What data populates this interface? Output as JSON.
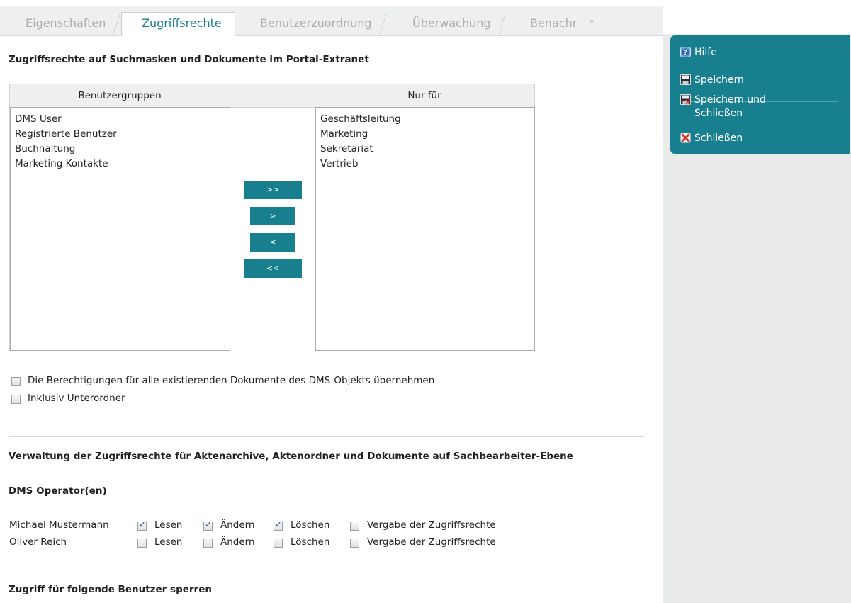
{
  "tabs": [
    "Eigenschaften",
    "Zugriffsrechte",
    "Benutzerzuordnung",
    "Überwachung",
    "Benachr"
  ],
  "tab_more": "»",
  "section_title": "Zugriffsrechte auf Suchmasken und Dokumente im Portal-Extranet",
  "transfer": {
    "left_header": "Benutzergruppen",
    "right_header": "Nur für",
    "left_items": [
      "DMS User",
      "Registrierte Benutzer",
      "Buchhaltung",
      "Marketing Kontakte"
    ],
    "right_items": [
      "Geschäftsleitung",
      "Marketing",
      "Sekretariat",
      "Vertrieb"
    ],
    "buttons": [
      ">>",
      ">",
      "<",
      "<<"
    ]
  },
  "options": {
    "apply_existing": "Die Berechtigungen für alle existierenden Dokumente des DMS-Objekts übernehmen",
    "include_subfolders": "Inklusiv Unterordner"
  },
  "management_title": "Verwaltung der Zugriffsrechte für Aktenarchive, Aktenordner und Dokumente auf Sachbearbeiter-Ebene",
  "operators_title": "DMS Operator(en)",
  "perm_labels": {
    "read": "Lesen",
    "change": "Ändern",
    "delete": "Löschen",
    "grant": "Vergabe der Zugriffsrechte"
  },
  "operators": [
    {
      "name": "Michael Mustermann",
      "read": true,
      "change": true,
      "delete": true,
      "grant": false
    },
    {
      "name": "Oliver Reich",
      "read": false,
      "change": false,
      "delete": false,
      "grant": false
    }
  ],
  "block_title": "Zugriff für folgende Benutzer sperren",
  "actions": {
    "help": "Hilfe",
    "save": "Speichern",
    "save_close": "Speichern und Schließen",
    "save_close_line1": "Speichern und",
    "save_close_line2": "Schließen",
    "close": "Schließen"
  },
  "colors": {
    "accent": "#177f8e",
    "active_tab_text": "#1a7f92",
    "close_icon": "#d9362b"
  }
}
